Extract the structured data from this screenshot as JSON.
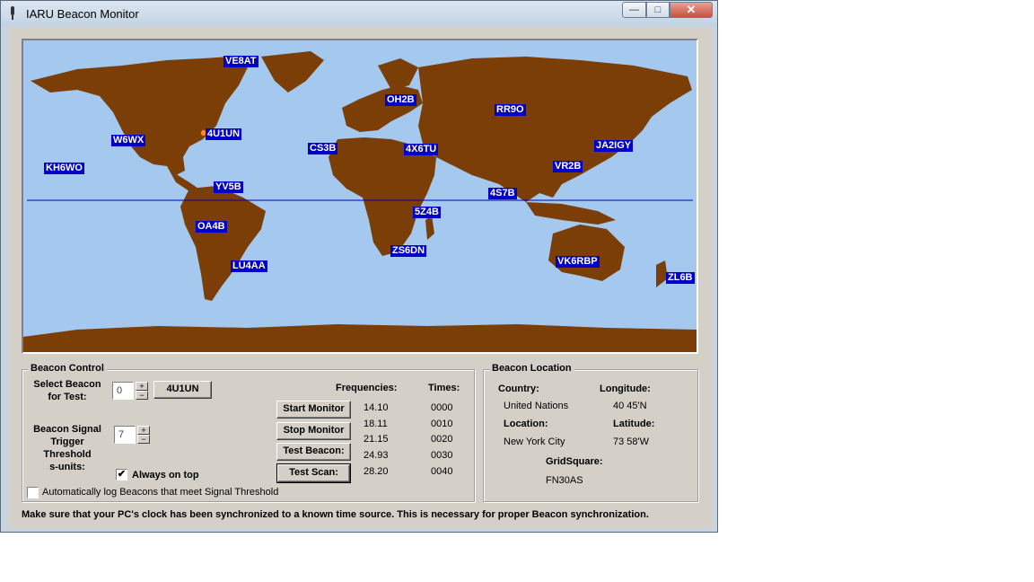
{
  "window": {
    "title": "IARU Beacon Monitor",
    "minimize": "—",
    "maximize": "□",
    "close": "✕"
  },
  "map": {
    "colors": {
      "ocean": "#a5c8ee",
      "land": "#7a3e06",
      "equator": "#0000b0",
      "label_bg": "#0000c8"
    },
    "beacons": [
      {
        "call": "VE8AT"
      },
      {
        "call": "OH2B"
      },
      {
        "call": "RR9O"
      },
      {
        "call": "W6WX"
      },
      {
        "call": "4U1UN"
      },
      {
        "call": "CS3B"
      },
      {
        "call": "4X6TU"
      },
      {
        "call": "JA2IGY"
      },
      {
        "call": "KH6WO"
      },
      {
        "call": "VR2B"
      },
      {
        "call": "YV5B"
      },
      {
        "call": "4S7B"
      },
      {
        "call": "5Z4B"
      },
      {
        "call": "OA4B"
      },
      {
        "call": "ZS6DN"
      },
      {
        "call": "VK6RBP"
      },
      {
        "call": "LU4AA"
      },
      {
        "call": "ZL6B"
      }
    ]
  },
  "control": {
    "title": "Beacon Control",
    "select_label": "Select Beacon\nfor Test:",
    "select_value": "0",
    "selected_call": "4U1UN",
    "threshold_label": "Beacon Signal\nTrigger\nThreshold\ns-units:",
    "threshold_value": "7",
    "spin_up": "+",
    "spin_down": "−",
    "always_on_top": "Always on top",
    "always_on_top_checked": "✔",
    "auto_log": "Automatically log Beacons that meet Signal Threshold",
    "frequencies_header": "Frequencies:",
    "times_header": "Times:",
    "frequencies": [
      "14.10",
      "18.11",
      "21.15",
      "24.93",
      "28.20"
    ],
    "times": [
      "0000",
      "0010",
      "0020",
      "0030",
      "0040"
    ],
    "buttons": {
      "start": "Start Monitor",
      "stop": "Stop Monitor",
      "test_beacon": "Test Beacon:",
      "test_scan": "Test Scan:"
    }
  },
  "location": {
    "title": "Beacon Location",
    "country_label": "Country:",
    "country_value": "United Nations",
    "longitude_label": "Longitude:",
    "longitude_value": "40 45'N",
    "location_label": "Location:",
    "location_value": "New York City",
    "latitude_label": "Latitude:",
    "latitude_value": "73 58'W",
    "grid_label": "GridSquare:",
    "grid_value": "FN30AS"
  },
  "footer": "Make sure that your PC's clock has been synchronized  to a known time source.  This is necessary for proper Beacon synchronization."
}
